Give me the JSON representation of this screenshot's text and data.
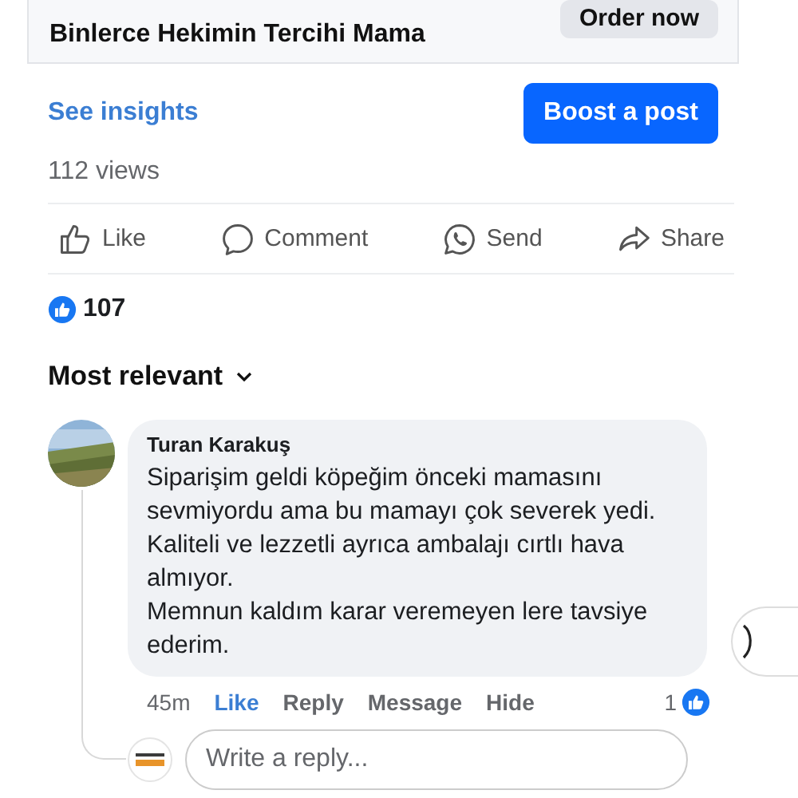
{
  "ad": {
    "headline": "Binlerce Hekimin Tercihi Mama",
    "cta": "Order now"
  },
  "insights_link": "See insights",
  "boost_button": "Boost a post",
  "views": "112 views",
  "actions": [
    {
      "kind": "like",
      "label": "Like"
    },
    {
      "kind": "comment",
      "label": "Comment"
    },
    {
      "kind": "send",
      "label": "Send"
    },
    {
      "kind": "share",
      "label": "Share"
    }
  ],
  "reactions": {
    "count": "107"
  },
  "sort": {
    "label": "Most relevant"
  },
  "comment": {
    "author": "Turan Karakuş",
    "paragraphs": [
      "Siparişim geldi köpeğim önceki mamasını sevmiyordu ama bu mamayı çok severek yedi.",
      "Kaliteli ve lezzetli ayrıca ambalajı cırtlı hava almıyor.",
      "Memnun kaldım karar veremeyen lere tavsiye ederim."
    ],
    "time": "45m",
    "liked": true,
    "like_label": "Like",
    "buttons": [
      "Reply",
      "Message",
      "Hide"
    ],
    "reaction_count": "1"
  },
  "reply_field": {
    "placeholder": "Write a reply..."
  }
}
